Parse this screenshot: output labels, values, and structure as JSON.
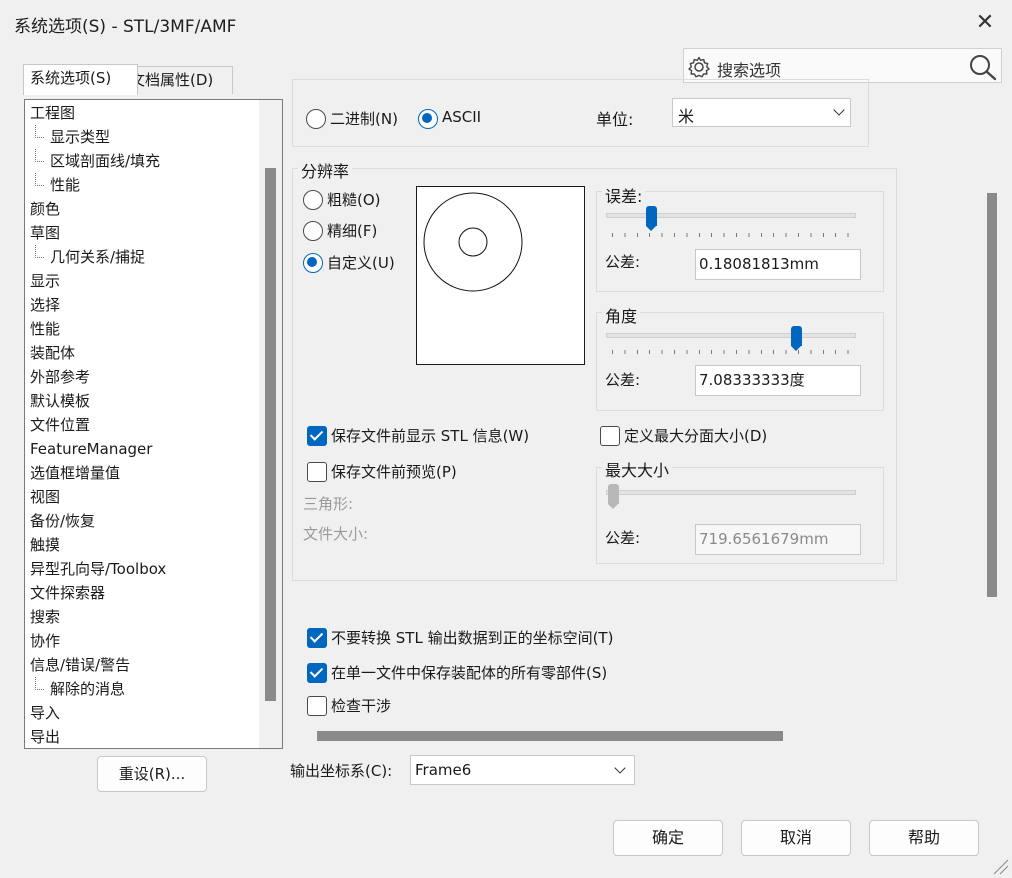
{
  "window": {
    "title": "系统选项(S) - STL/3MF/AMF",
    "close_glyph": "✕"
  },
  "search": {
    "placeholder": "搜索选项"
  },
  "tabs": [
    {
      "label": "系统选项(S)"
    },
    {
      "label": "文档属性(D)"
    }
  ],
  "tree": {
    "items": [
      {
        "label": "工程图",
        "indent": 0
      },
      {
        "label": "显示类型",
        "indent": 1
      },
      {
        "label": "区域剖面线/填充",
        "indent": 1
      },
      {
        "label": "性能",
        "indent": 1
      },
      {
        "label": "颜色",
        "indent": 0
      },
      {
        "label": "草图",
        "indent": 0
      },
      {
        "label": "几何关系/捕捉",
        "indent": 1
      },
      {
        "label": "显示",
        "indent": 0
      },
      {
        "label": "选择",
        "indent": 0
      },
      {
        "label": "性能",
        "indent": 0
      },
      {
        "label": "装配体",
        "indent": 0
      },
      {
        "label": "外部参考",
        "indent": 0
      },
      {
        "label": "默认模板",
        "indent": 0
      },
      {
        "label": "文件位置",
        "indent": 0
      },
      {
        "label": "FeatureManager",
        "indent": 0
      },
      {
        "label": "选值框增量值",
        "indent": 0
      },
      {
        "label": "视图",
        "indent": 0
      },
      {
        "label": "备份/恢复",
        "indent": 0
      },
      {
        "label": "触摸",
        "indent": 0
      },
      {
        "label": "异型孔向导/Toolbox",
        "indent": 0
      },
      {
        "label": "文件探索器",
        "indent": 0
      },
      {
        "label": "搜索",
        "indent": 0
      },
      {
        "label": "协作",
        "indent": 0
      },
      {
        "label": "信息/错误/警告",
        "indent": 0
      },
      {
        "label": "解除的消息",
        "indent": 1
      },
      {
        "label": "导入",
        "indent": 0
      },
      {
        "label": "导出",
        "indent": 0
      }
    ]
  },
  "reset_button": "重设(R)...",
  "format": {
    "binary_label": "二进制(N)",
    "ascii_label": "ASCII",
    "selected": "ASCII"
  },
  "unit": {
    "label": "单位:",
    "value": "米"
  },
  "resolution": {
    "legend": "分辨率",
    "options": [
      {
        "label": "粗糙(O)"
      },
      {
        "label": "精细(F)"
      },
      {
        "label": "自定义(U)"
      }
    ],
    "selected": "自定义(U)",
    "deviation": {
      "legend": "误差:",
      "tolerance_label": "公差:",
      "tolerance_value": "0.18081813mm",
      "slider_fraction": 0.18
    },
    "angle": {
      "legend": "角度",
      "tolerance_label": "公差:",
      "tolerance_value": "7.08333333度",
      "slider_fraction": 0.76
    },
    "show_stl_info": {
      "label": "保存文件前显示 STL 信息(W)",
      "checked": true
    },
    "preview": {
      "label": "保存文件前预览(P)",
      "checked": false
    },
    "triangles_label": "三角形:",
    "filesize_label": "文件大小:",
    "define_max_facet": {
      "label": "定义最大分面大小(D)",
      "checked": false
    },
    "max_size": {
      "legend": "最大大小",
      "tolerance_label": "公差:",
      "tolerance_value": "719.6561679mm",
      "slider_fraction": 0.0
    }
  },
  "options": {
    "no_translate": {
      "label": "不要转换 STL 输出数据到正的坐标空间(T)",
      "checked": true
    },
    "save_all_parts": {
      "label": "在单一文件中保存装配体的所有零部件(S)",
      "checked": true
    },
    "check_interference": {
      "label": "检查干涉",
      "checked": false
    }
  },
  "output_cs": {
    "label": "输出坐标系(C):",
    "value": "Frame6"
  },
  "buttons": {
    "ok": "确定",
    "cancel": "取消",
    "help": "帮助"
  },
  "colors": {
    "accent": "#0067c0"
  }
}
